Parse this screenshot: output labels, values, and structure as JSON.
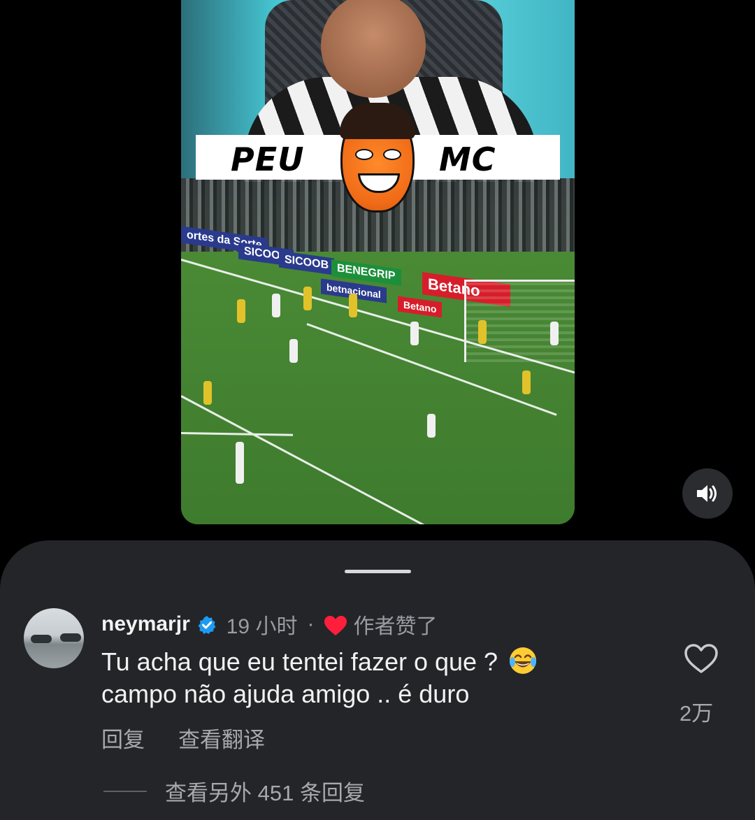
{
  "video": {
    "banner_left": "PEU",
    "banner_right": "MC",
    "ads": [
      "ortes da Sorte",
      "SICOOB",
      "SICOOB",
      "BENEGRIP",
      "betnacional",
      "Betano",
      "Betano"
    ]
  },
  "sound_button": {
    "icon": "speaker-icon"
  },
  "comment": {
    "username": "neymarjr",
    "time": "19 小时",
    "separator": "·",
    "liked_by_author": "作者赞了",
    "text_line1": "Tu acha que eu tentei fazer o que ?",
    "text_line2": "campo não ajuda amigo .. é duro",
    "reply_label": "回复",
    "translate_label": "查看翻译",
    "like_count": "2万",
    "more_replies": "查看另外 451 条回复"
  },
  "colors": {
    "sheet_bg": "#232529",
    "verified_blue": "#1d9bf0",
    "heart_red": "#ff1f3d",
    "muted_text": "#9a9ca1"
  }
}
